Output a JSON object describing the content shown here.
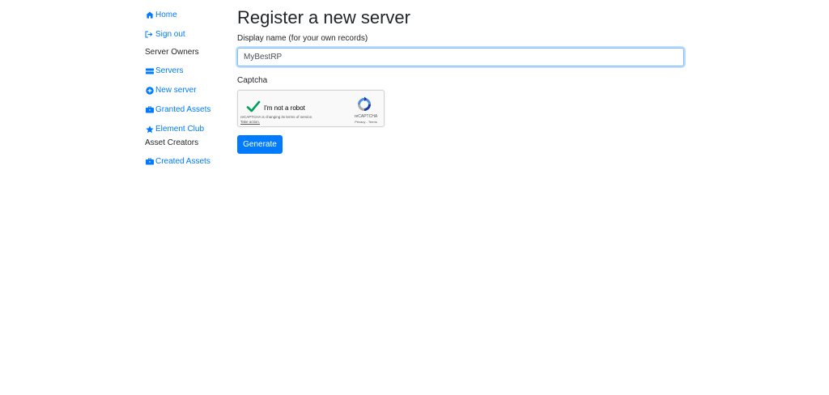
{
  "sidebar": {
    "home": "Home",
    "sign_out": "Sign out",
    "server_owners_heading": "Server Owners",
    "servers": "Servers",
    "new_server": "New server",
    "granted_assets": "Granted Assets",
    "element_club": "Element Club",
    "asset_creators_heading": "Asset Creators",
    "created_assets": "Created Assets"
  },
  "icons": {
    "home": "home-icon",
    "sign_out": "sign-out-icon",
    "servers": "server-icon",
    "new_server": "plus-circle-icon",
    "granted_assets": "briefcase-icon",
    "element_club": "star-icon",
    "created_assets": "briefcase-icon"
  },
  "main": {
    "title": "Register a new server",
    "display_name_label": "Display name (for your own records)",
    "display_name_value": "MyBestRP",
    "captcha_label": "Captcha",
    "generate_button": "Generate"
  },
  "captcha": {
    "checkbox_label": "I'm not a robot",
    "notice": "reCAPTCHA is changing its terms of service.",
    "notice_link": "Take action.",
    "brand": "reCAPTCHA",
    "privacy": "Privacy",
    "separator": " - ",
    "terms": "Terms",
    "checked": true
  },
  "colors": {
    "link": "#007bff",
    "primary_button": "#007bff",
    "checkmark": "#00a05a"
  }
}
